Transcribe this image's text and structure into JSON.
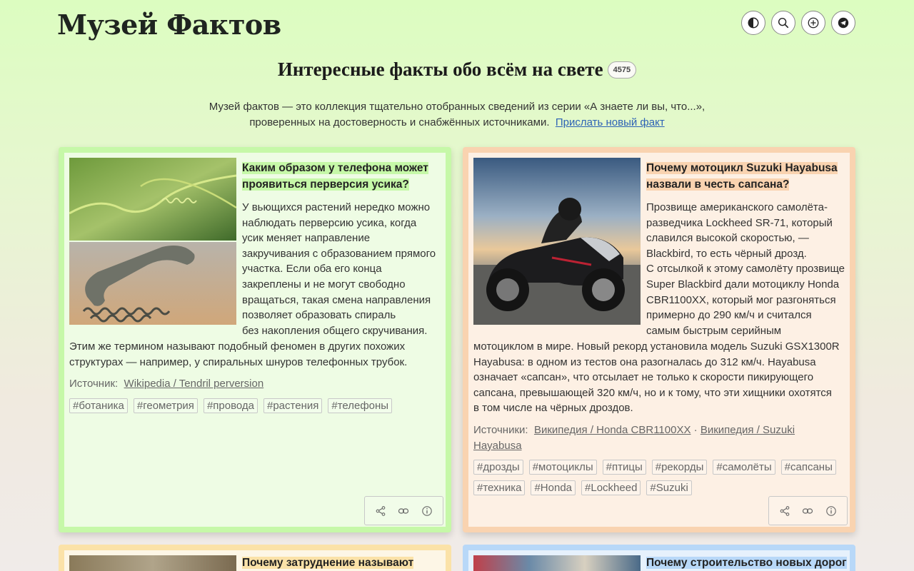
{
  "header": {
    "logo": "Музей Фактов",
    "buttons": [
      {
        "name": "theme-toggle-icon"
      },
      {
        "name": "search-icon"
      },
      {
        "name": "add-icon"
      },
      {
        "name": "telegram-icon"
      }
    ]
  },
  "intro": {
    "title": "Интересные факты обо всём на свете",
    "count": "4575",
    "description_line1": "Музей фактов — это коллекция тщательно отобранных сведений из серии «А знаете ли вы, что...»,",
    "description_line2": "проверенных на достоверность и снабжённых источниками.",
    "submit_link": "Прислать новый факт"
  },
  "cards": [
    {
      "title": "Каким образом у телефона может проявиться перверсия усика?",
      "title_line1": "Каким образом у телефона может",
      "title_line2": "проявиться перверсия усика?",
      "body_lines": [
        "У вьющихся растений нередко можно",
        "наблюдать перверсию усика, когда",
        "усик меняет направление",
        "закручивания с образованием прямого",
        "участка. Если оба его конца",
        "закреплены и не могут свободно",
        "вращаться, такая смена направления",
        "позволяет образовать спираль",
        "без накопления общего скручивания."
      ],
      "body_full_lines": [
        "Этим же термином называют подобный феномен в других похожих",
        "структурах — например, у спиральных шнуров телефонных трубок."
      ],
      "sources_label": "Источник:",
      "sources": [
        "Wikipedia / Tendril perversion"
      ],
      "tags": [
        "#ботаника",
        "#геометрия",
        "#провода",
        "#растения",
        "#телефоны"
      ]
    },
    {
      "title": "Почему мотоцикл Suzuki Hayabusa назвали в честь сапсана?",
      "title_line1": "Почему мотоцикл Suzuki Hayabusa",
      "title_line2": "назвали в честь сапсана?",
      "body_lines": [
        "Прозвище американского самолёта-",
        "разведчика Lockheed SR-71, который",
        "славился высокой скоростью, —",
        "Blackbird, то есть чёрный дрозд.",
        "С отсылкой к этому самолёту прозвище",
        "Super Blackbird дали мотоциклу Honda",
        "CBR1100XX, который мог разгоняться",
        "примерно до 290 км/ч и считался",
        "самым быстрым серийным"
      ],
      "body_full_lines": [
        "мотоциклом в мире. Новый рекорд установила модель Suzuki GSX1300R",
        "Hayabusa: в одном из тестов она разогналась до 312 км/ч. Hayabusa",
        "означает «сапсан», что отсылает не только к скорости пикирующего",
        "сапсана, превышающей 320 км/ч, но и к тому, что эти хищники охотятся",
        "в том числе на чёрных дроздов."
      ],
      "sources_label": "Источники:",
      "sources": [
        "Википедия / Honda CBR1100XX",
        "Википедия / Suzuki",
        "Hayabusa"
      ],
      "tags": [
        "#дрозды",
        "#мотоциклы",
        "#птицы",
        "#рекорды",
        "#самолёты",
        "#сапсаны",
        "#техника",
        "#Honda",
        "#Lockheed",
        "#Suzuki"
      ]
    },
    {
      "title": "Почему затруднение называют"
    },
    {
      "title": "Почему строительство новых дорог"
    }
  ],
  "colors": {
    "card1_border": "#c6f8a8",
    "card2_border": "#f9d3b0",
    "card3_border": "#fbe2a8",
    "card4_border": "#b8d8f8",
    "link": "#2d62b5"
  }
}
